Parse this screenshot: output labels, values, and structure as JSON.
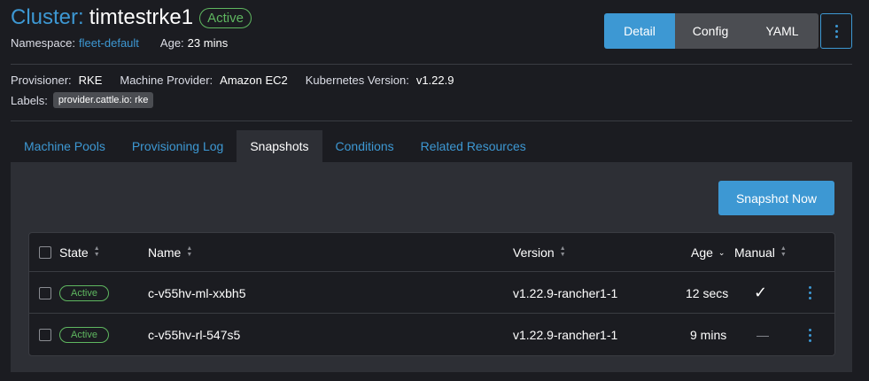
{
  "header": {
    "prefix": "Cluster:",
    "name": "timtestrke1",
    "status": "Active",
    "namespace_label": "Namespace:",
    "namespace_value": "fleet-default",
    "age_label": "Age:",
    "age_value": "23 mins"
  },
  "view_switch": {
    "detail": "Detail",
    "config": "Config",
    "yaml": "YAML"
  },
  "info": {
    "provisioner_label": "Provisioner:",
    "provisioner_value": "RKE",
    "machine_provider_label": "Machine Provider:",
    "machine_provider_value": "Amazon EC2",
    "k8s_version_label": "Kubernetes Version:",
    "k8s_version_value": "v1.22.9",
    "labels_label": "Labels:",
    "label_tag": "provider.cattle.io: rke"
  },
  "tabs": [
    {
      "label": "Machine Pools"
    },
    {
      "label": "Provisioning Log"
    },
    {
      "label": "Snapshots",
      "active": true
    },
    {
      "label": "Conditions"
    },
    {
      "label": "Related Resources"
    }
  ],
  "snapshot_button": "Snapshot Now",
  "table": {
    "headers": {
      "state": "State",
      "name": "Name",
      "version": "Version",
      "age": "Age",
      "manual": "Manual"
    },
    "rows": [
      {
        "state": "Active",
        "name": "c-v55hv-ml-xxbh5",
        "version": "v1.22.9-rancher1-1",
        "age": "12 secs",
        "manual": "check-icon"
      },
      {
        "state": "Active",
        "name": "c-v55hv-rl-547s5",
        "version": "v1.22.9-rancher1-1",
        "age": "9 mins",
        "manual": "—"
      }
    ]
  },
  "colors": {
    "accent": "#3d98d3",
    "active_green": "#5fb760",
    "background": "#1b1c21",
    "panel": "#2d2f35"
  }
}
